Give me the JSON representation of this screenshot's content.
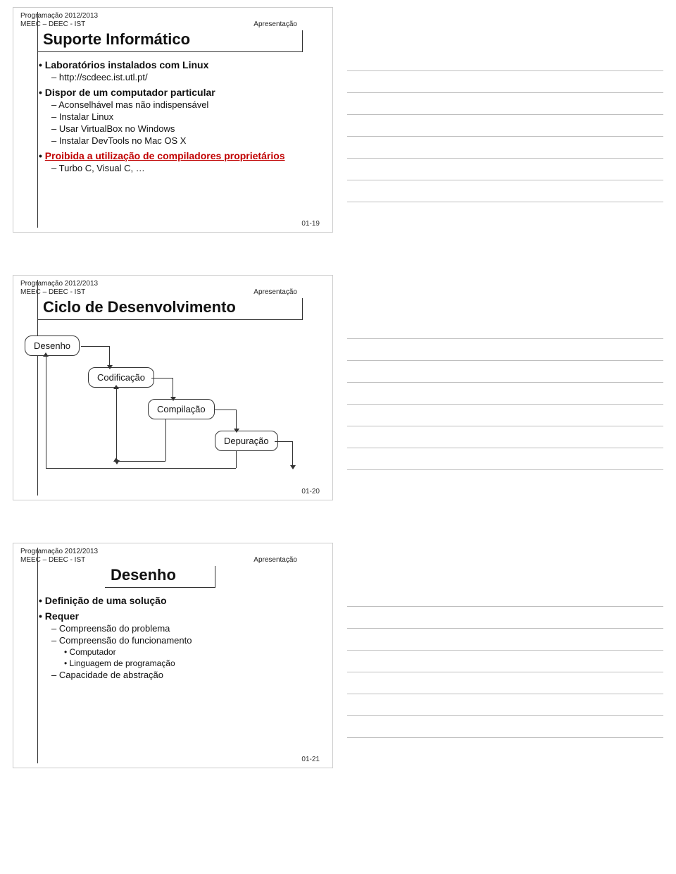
{
  "slide1": {
    "course": "Programação 2012/2013",
    "dept": "MEEC – DEEC - IST",
    "label": "Apresentação",
    "title": "Suporte Informático",
    "bullets": {
      "b1a": "Laboratórios instalados com Linux",
      "b2a": "http://scdeec.ist.utl.pt/",
      "b1b": "Dispor de um computador particular",
      "b2b": "Aconselhável mas não indispensável",
      "b2c": "Instalar Linux",
      "b2d": "Usar VirtualBox no Windows",
      "b2e": "Instalar DevTools no Mac OS X",
      "b1c": "Proibida a utilização de compiladores proprietários",
      "b2f": "Turbo C, Visual C, …"
    },
    "page": "01-19"
  },
  "slide2": {
    "course": "Programação 2012/2013",
    "dept": "MEEC – DEEC - IST",
    "label": "Apresentação",
    "title": "Ciclo de Desenvolvimento",
    "boxes": {
      "a": "Desenho",
      "b": "Codificação",
      "c": "Compilação",
      "d": "Depuração"
    },
    "page": "01-20"
  },
  "slide3": {
    "course": "Programação 2012/2013",
    "dept": "MEEC – DEEC - IST",
    "label": "Apresentação",
    "title": "Desenho",
    "bullets": {
      "b1a": "Definição de uma solução",
      "b1b": "Requer",
      "b2a": "Compreensão do problema",
      "b2b": "Compreensão do funcionamento",
      "b3a": "Computador",
      "b3b": "Linguagem de programação",
      "b2c": "Capacidade de abstração"
    },
    "page": "01-21"
  }
}
